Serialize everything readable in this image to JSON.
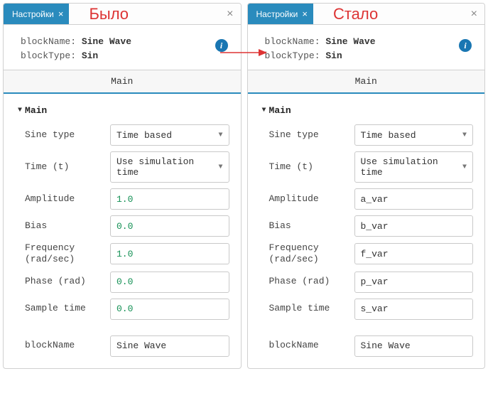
{
  "left": {
    "tab_label": "Настройки",
    "title": "Было",
    "blockName_label": "blockName:",
    "blockName_value": "Sine Wave",
    "blockType_label": "blockType:",
    "blockType_value": "Sin",
    "section_tab": "Main",
    "group": "Main",
    "rows": {
      "sine_type": {
        "label": "Sine type",
        "value": "Time based"
      },
      "time": {
        "label": "Time (t)",
        "value": "Use simulation time"
      },
      "amplitude": {
        "label": "Amplitude",
        "value": "1.0"
      },
      "bias": {
        "label": "Bias",
        "value": "0.0"
      },
      "frequency": {
        "label": "Frequency (rad/sec)",
        "value": "1.0"
      },
      "phase": {
        "label": "Phase (rad)",
        "value": "0.0"
      },
      "sample": {
        "label": "Sample time",
        "value": "0.0"
      },
      "blockName": {
        "label": "blockName",
        "value": "Sine Wave"
      }
    }
  },
  "right": {
    "tab_label": "Настройки",
    "title": "Стало",
    "blockName_label": "blockName:",
    "blockName_value": "Sine Wave",
    "blockType_label": "blockType:",
    "blockType_value": "Sin",
    "section_tab": "Main",
    "group": "Main",
    "rows": {
      "sine_type": {
        "label": "Sine type",
        "value": "Time based"
      },
      "time": {
        "label": "Time (t)",
        "value": "Use simulation time"
      },
      "amplitude": {
        "label": "Amplitude",
        "value": "a_var"
      },
      "bias": {
        "label": "Bias",
        "value": "b_var"
      },
      "frequency": {
        "label": "Frequency (rad/sec)",
        "value": "f_var"
      },
      "phase": {
        "label": "Phase (rad)",
        "value": "p_var"
      },
      "sample": {
        "label": "Sample time",
        "value": "s_var"
      },
      "blockName": {
        "label": "blockName",
        "value": "Sine Wave"
      }
    }
  }
}
